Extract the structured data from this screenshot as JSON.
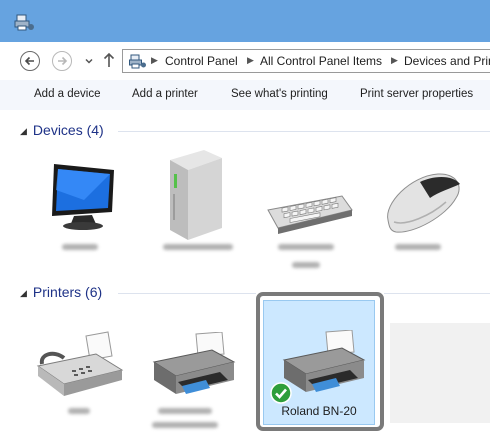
{
  "window": {
    "address": {
      "breadcrumbs": [
        "Control Panel",
        "All Control Panel Items",
        "Devices and Prin"
      ]
    }
  },
  "toolbar": {
    "add_device": "Add a device",
    "add_printer": "Add a printer",
    "see_printing": "See what's printing",
    "print_server": "Print server properties"
  },
  "groups": {
    "devices": {
      "title": "Devices (4)"
    },
    "printers": {
      "title": "Printers (6)"
    }
  },
  "printers": {
    "selected_label": "Roland BN-20"
  },
  "colors": {
    "titlebar": "#66a3e0",
    "selection_fill": "#cce8ff",
    "group_heading": "#1e3287",
    "highlight_border": "#7a7a7a"
  }
}
